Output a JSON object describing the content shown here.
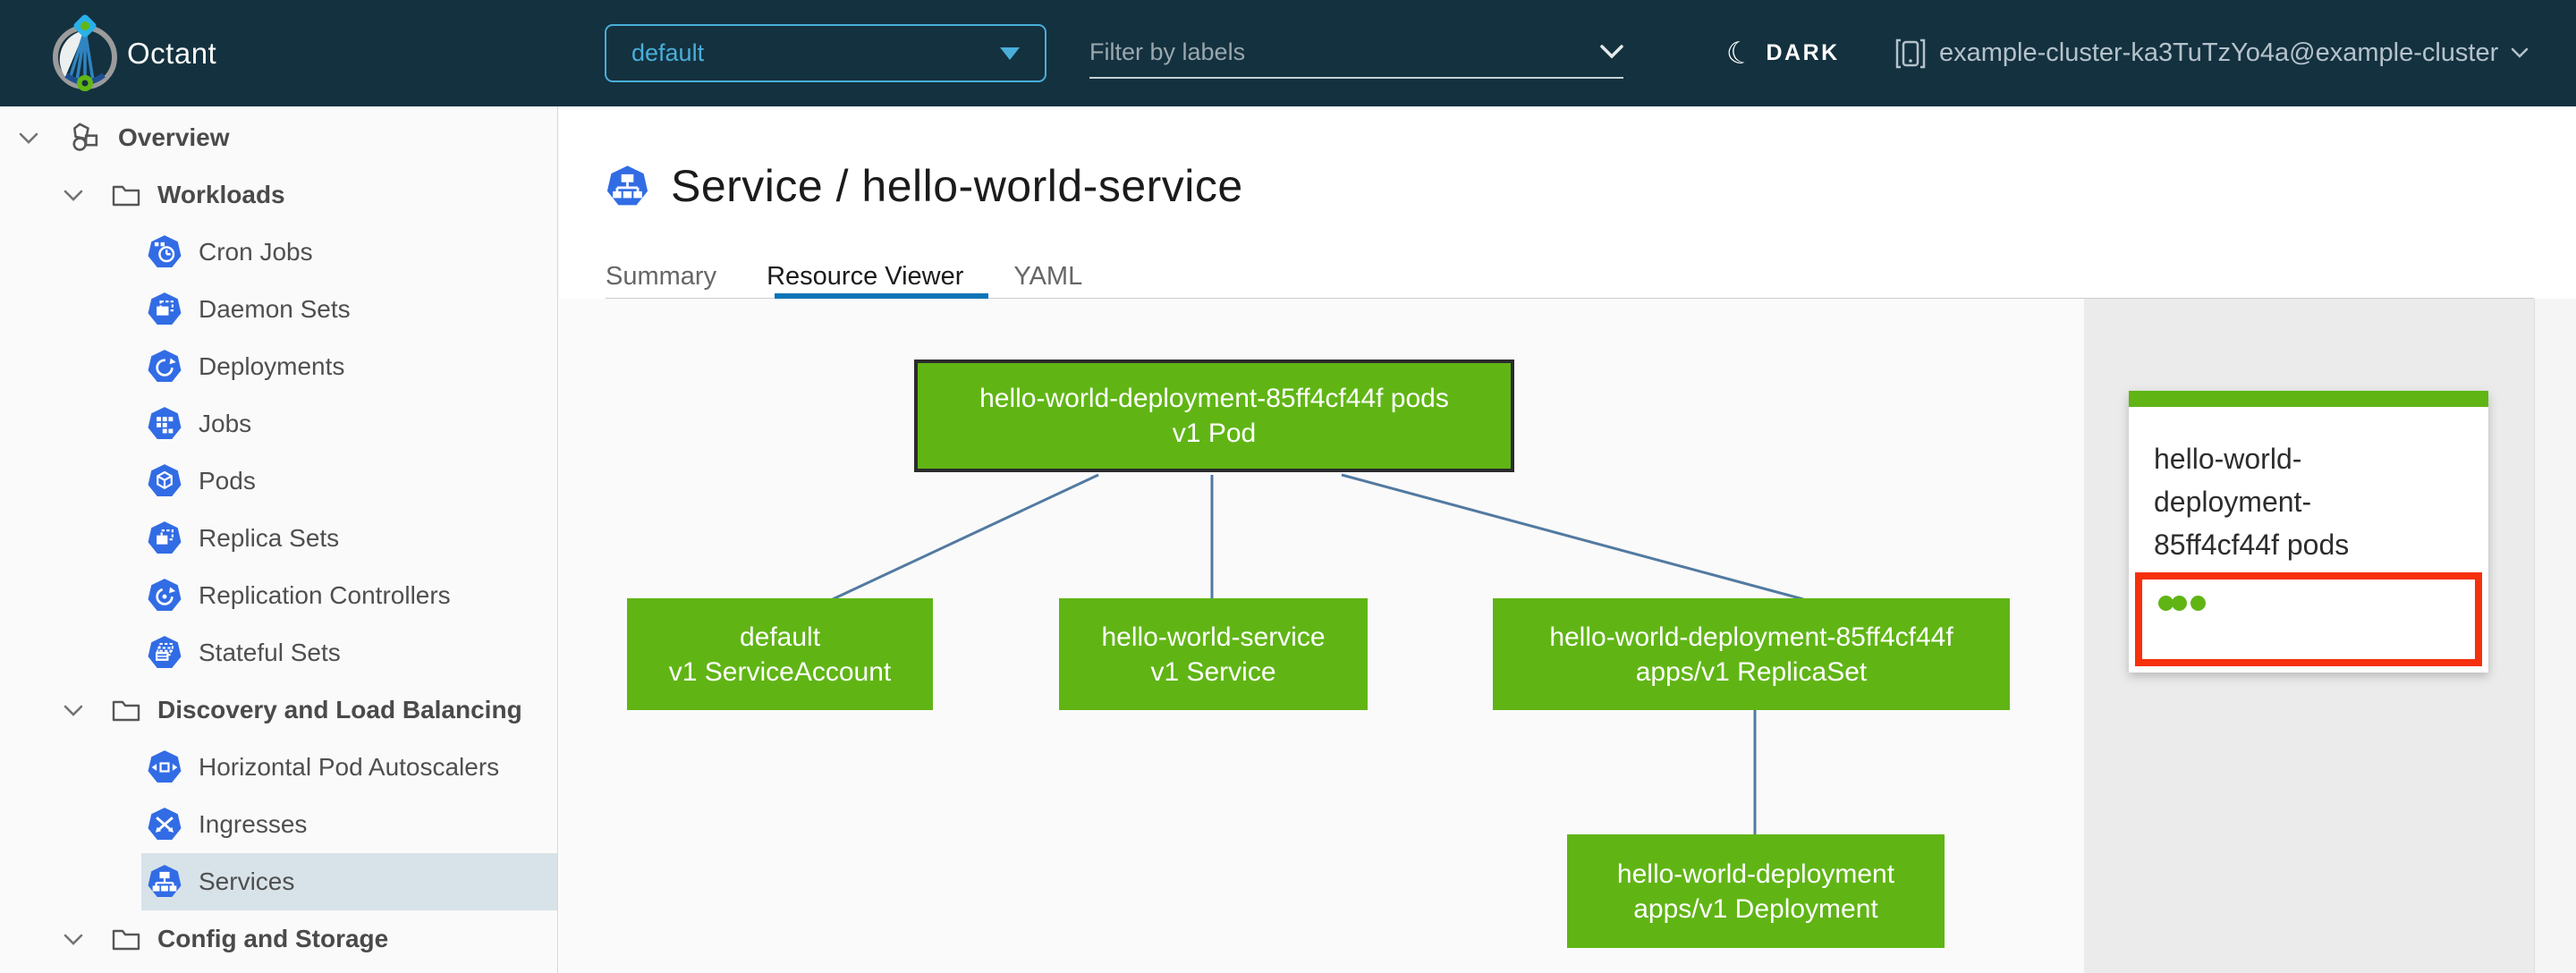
{
  "header": {
    "app_title": "Octant",
    "namespace_selector": {
      "value": "default"
    },
    "label_filter": {
      "placeholder": "Filter by labels"
    },
    "theme_toggle_label": "DARK",
    "context_selector": "example-cluster-ka3TuTzYo4a@example-cluster"
  },
  "sidebar": {
    "items": [
      {
        "label": "Overview",
        "icon": "applications-icon",
        "level": 0,
        "expanded": true,
        "selected": false
      },
      {
        "label": "Workloads",
        "icon": "folder-icon",
        "level": 1,
        "expanded": true,
        "selected": false
      },
      {
        "label": "Cron Jobs",
        "icon": "cronjob-icon",
        "level": 2,
        "selected": false
      },
      {
        "label": "Daemon Sets",
        "icon": "daemonset-icon",
        "level": 2,
        "selected": false
      },
      {
        "label": "Deployments",
        "icon": "deployment-icon",
        "level": 2,
        "selected": false
      },
      {
        "label": "Jobs",
        "icon": "job-icon",
        "level": 2,
        "selected": false
      },
      {
        "label": "Pods",
        "icon": "pod-icon",
        "level": 2,
        "selected": false
      },
      {
        "label": "Replica Sets",
        "icon": "replicaset-icon",
        "level": 2,
        "selected": false
      },
      {
        "label": "Replication Controllers",
        "icon": "replicationcontroller-icon",
        "level": 2,
        "selected": false
      },
      {
        "label": "Stateful Sets",
        "icon": "statefulset-icon",
        "level": 2,
        "selected": false
      },
      {
        "label": "Discovery and Load Balancing",
        "icon": "folder-icon",
        "level": 1,
        "expanded": true,
        "selected": false
      },
      {
        "label": "Horizontal Pod Autoscalers",
        "icon": "hpa-icon",
        "level": 2,
        "selected": false
      },
      {
        "label": "Ingresses",
        "icon": "ingress-icon",
        "level": 2,
        "selected": false
      },
      {
        "label": "Services",
        "icon": "service-icon",
        "level": 2,
        "selected": true
      },
      {
        "label": "Config and Storage",
        "icon": "folder-icon",
        "level": 1,
        "expanded": true,
        "selected": false
      }
    ]
  },
  "main": {
    "title": "Service / hello-world-service",
    "title_icon": "service-icon",
    "tabs": [
      {
        "label": "Summary",
        "active": false
      },
      {
        "label": "Resource Viewer",
        "active": true
      },
      {
        "label": "YAML",
        "active": false
      }
    ]
  },
  "graph": {
    "nodes": {
      "pod": {
        "line1": "hello-world-deployment-85ff4cf44f pods",
        "line2": "v1 Pod",
        "selected": true
      },
      "serviceaccount": {
        "line1": "default",
        "line2": "v1 ServiceAccount",
        "selected": false
      },
      "service": {
        "line1": "hello-world-service",
        "line2": "v1 Service",
        "selected": false
      },
      "replicaset": {
        "line1": "hello-world-deployment-85ff4cf44f",
        "line2": "apps/v1 ReplicaSet",
        "selected": false
      },
      "deployment": {
        "line1": "hello-world-deployment",
        "line2": "apps/v1 Deployment",
        "selected": false
      }
    },
    "edges": [
      [
        "pod",
        "serviceaccount"
      ],
      [
        "pod",
        "service"
      ],
      [
        "pod",
        "replicaset"
      ],
      [
        "replicaset",
        "deployment"
      ]
    ]
  },
  "detail_panel": {
    "card": {
      "title": "hello-world-deployment-85ff4cf44f pods",
      "pod_count": 3,
      "highlighted": true
    }
  },
  "colors": {
    "header_bg": "#14313f",
    "accent_blue": "#49afd9",
    "kubernetes_blue": "#326ce5",
    "node_green": "#60b515",
    "edge_blue": "#527aa1",
    "tab_underline": "#0d74b8",
    "highlight_red": "#f5300d",
    "selected_row_bg": "#d8e3e9",
    "panel_gray": "#ebebeb"
  }
}
